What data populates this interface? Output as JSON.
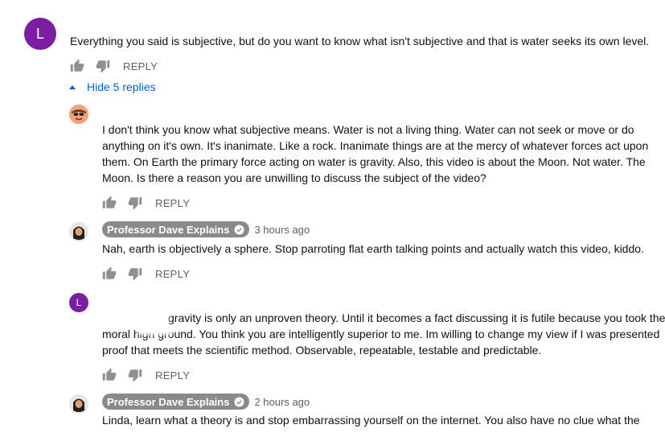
{
  "colors": {
    "avatar_purple": "#7b1fa2",
    "link_blue": "#065fd4",
    "chip_gray": "#8a8a8a"
  },
  "top_comment": {
    "avatar_letter": "L",
    "text": "Everything you said is subjective, but do you want to know what isn't subjective and that is water seeks its own level.",
    "reply_label": "REPLY"
  },
  "hide_replies_label": "Hide 5 replies",
  "replies": [
    {
      "lines": [
        "I don't think you know what subjective means.  Water is not a living thing.  Water can not seek or move or do",
        "anything on it's own.  It's inanimate.  Like a rock.  Inanimate things are at the mercy of whatever forces act upon",
        "them.  On Earth the primary force acting on water is gravity.  Also, this video is about the Moon.  Not water.  The",
        "Moon.  Is there a reason you are unwilling to discuss the subject of the video?"
      ],
      "reply_label": "REPLY"
    },
    {
      "author": "Professor Dave Explains",
      "time": "3 hours ago",
      "lines": [
        "Nah, earth is objectively a sphere. Stop parroting flat earth talking points and actually watch this video, kiddo."
      ],
      "reply_label": "REPLY"
    },
    {
      "avatar_letter": "L",
      "lines": [
        "gravity is only an unproven theory. Until it becomes a fact discussing it is futile because you took the",
        "moral high ground. You think you are  intelligently superior to me. Im willing to change my view if I was presented",
        "proof that meets the scientific method. Observable, repeatable, testable and predictable."
      ],
      "reply_label": "REPLY"
    },
    {
      "author": "Professor Dave Explains",
      "time": "2 hours ago",
      "lines": [
        "Linda, learn what a theory is and stop embarrassing yourself on the internet. You also have no clue what the"
      ]
    }
  ]
}
